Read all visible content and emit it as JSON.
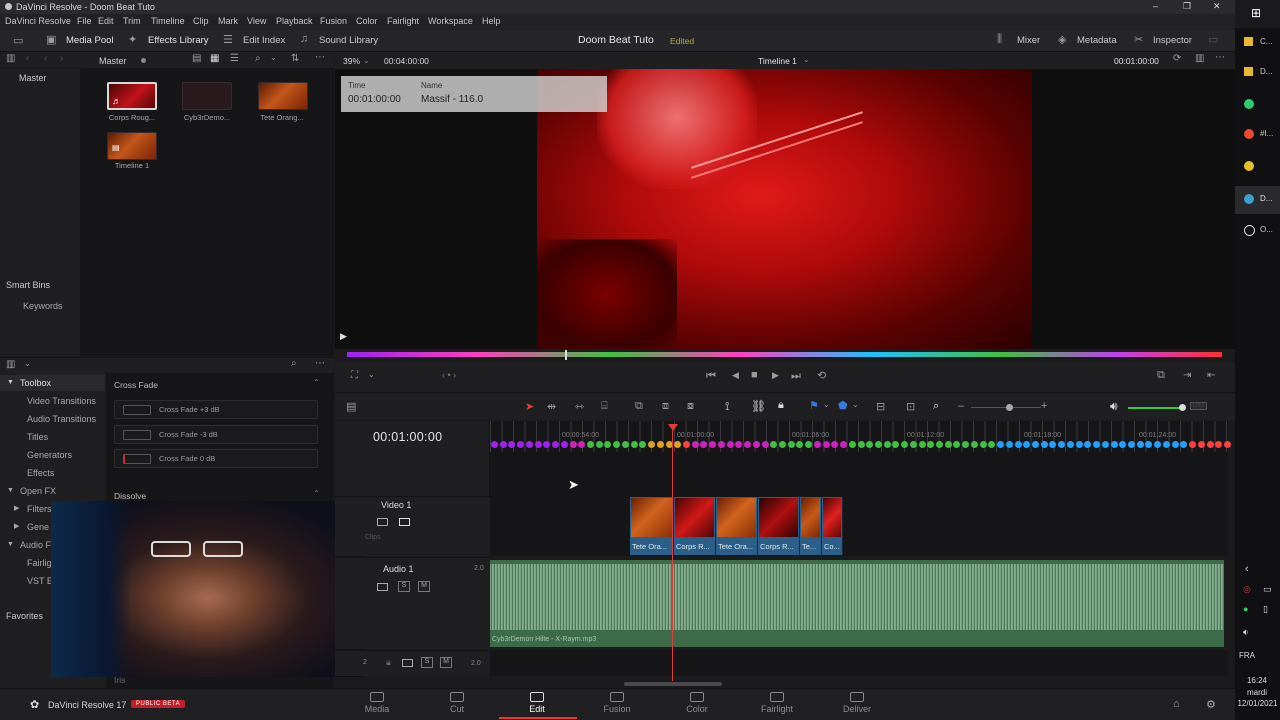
{
  "window": {
    "title": "DaVinci Resolve - Doom Beat Tuto",
    "controls": [
      "–",
      "❐",
      "✕"
    ]
  },
  "menu": [
    "DaVinci Resolve",
    "File",
    "Edit",
    "Trim",
    "Timeline",
    "Clip",
    "Mark",
    "View",
    "Playback",
    "Fusion",
    "Color",
    "Fairlight",
    "Workspace",
    "Help"
  ],
  "toolbar": {
    "media_pool": "Media Pool",
    "effects_library": "Effects Library",
    "edit_index": "Edit Index",
    "sound_library": "Sound Library",
    "project_title": "Doom Beat Tuto",
    "project_status": "Edited",
    "mixer": "Mixer",
    "metadata": "Metadata",
    "inspector": "Inspector"
  },
  "media_pool": {
    "bin": "Master",
    "tree_root": "Master",
    "smart_bins": "Smart Bins",
    "keywords": "Keywords",
    "clips": [
      {
        "name": "Corps Roug...",
        "kind": "audio-video"
      },
      {
        "name": "Cyb3rDemo...",
        "kind": "audio"
      },
      {
        "name": "Tete Orang...",
        "kind": "video"
      },
      {
        "name": "Timeline 1",
        "kind": "timeline"
      }
    ]
  },
  "viewer": {
    "zoom": "39%",
    "source_tc": "00:04:00:00",
    "timeline_name": "Timeline 1",
    "record_tc": "00:01:00:00",
    "overlay": {
      "time_label": "Time",
      "time_value": "00:01:00:00",
      "name_label": "Name",
      "name_value": "Massif - 116.0"
    }
  },
  "effects": {
    "toolbox": "Toolbox",
    "items": [
      "Video Transitions",
      "Audio Transitions",
      "Titles",
      "Generators",
      "Effects"
    ],
    "open_fx": "Open FX",
    "open_fx_items": [
      "Filters",
      "Gene"
    ],
    "audio_fx": "Audio F",
    "audio_fx_items": [
      "Fairlig",
      "VST E"
    ],
    "favorites": "Favorites",
    "cross_fade_header": "Cross Fade",
    "cross_fades": [
      "Cross Fade +3 dB",
      "Cross Fade -3 dB",
      "Cross Fade 0 dB"
    ],
    "dissolve_header": "Dissolve",
    "iris_header": "Iris"
  },
  "timeline": {
    "timecode": "00:01:00:00",
    "ruler": [
      "00:00:54:00",
      "00:01:00:00",
      "00:01:06:00",
      "00:01:12:00",
      "00:01:18:00",
      "00:01:24:00"
    ],
    "video_track": "Video 1",
    "audio_track": "Audio 1",
    "audio_level": "2.0",
    "audio_track2_level": "2.0",
    "audio_track2_num": "2",
    "clips_hint": "Clips",
    "audio_clip_name": "Cyb3rDemon Hilte - X-Raym.mp3",
    "video_clips": [
      "Tete Ora...",
      "Corps R...",
      "Tete Ora...",
      "Corps R...",
      "Te...",
      "Co..."
    ]
  },
  "pages": [
    "Media",
    "Cut",
    "Edit",
    "Fusion",
    "Color",
    "Fairlight",
    "Deliver"
  ],
  "active_page": "Edit",
  "footer": {
    "app": "DaVinci Resolve 17",
    "badge": "PUBLIC BETA"
  },
  "taskbar": {
    "apps": [
      "C...",
      "D...",
      "",
      "#I...",
      "",
      "D...",
      "O..."
    ],
    "lang": "FRA",
    "time": "16:24",
    "day": "mardi",
    "date": "12/01/2021"
  },
  "colors": {
    "accent": "#e33b3b",
    "clip_blue": "#2a5f8a",
    "audio_green": "#4d7a58"
  }
}
